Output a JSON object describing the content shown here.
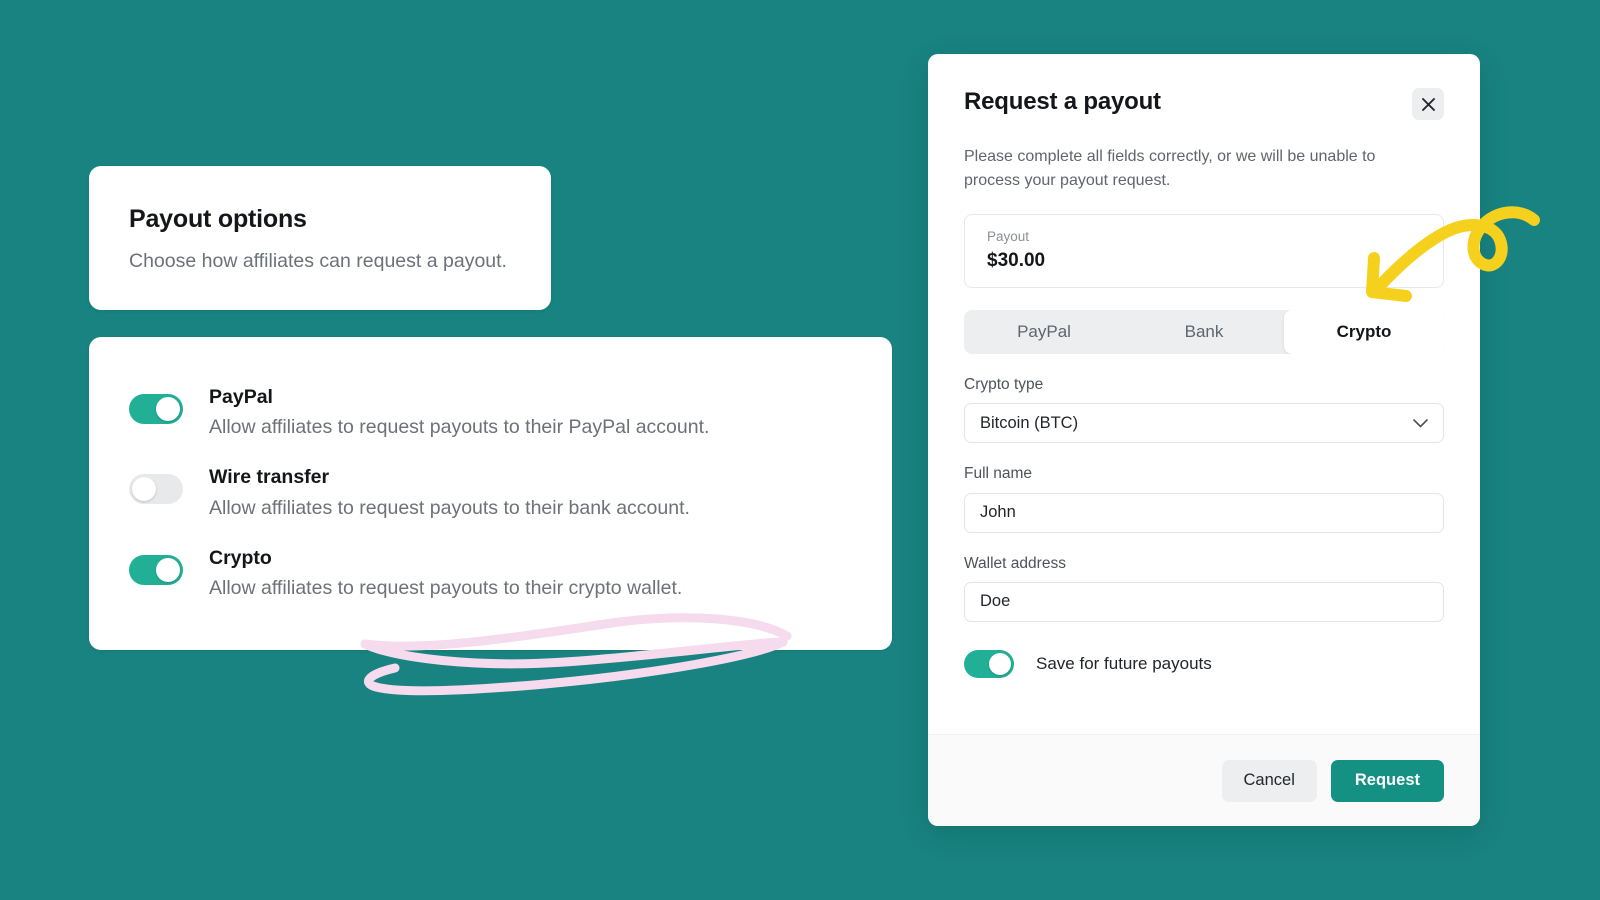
{
  "theme": {
    "background": "#188380",
    "accent_green": "#21b096",
    "primary_button": "#159184",
    "annotation_yellow": "#F5D11E",
    "annotation_pink": "#F6DAEE"
  },
  "payout_options_card": {
    "title": "Payout options",
    "subtitle": "Choose how affiliates can request a payout.",
    "options": [
      {
        "name": "PayPal",
        "description": "Allow affiliates to request payouts to their PayPal account.",
        "enabled": true
      },
      {
        "name": "Wire transfer",
        "description": "Allow affiliates to request payouts to their bank account.",
        "enabled": false
      },
      {
        "name": "Crypto",
        "description": "Allow affiliates to request payouts to their crypto wallet.",
        "enabled": true
      }
    ]
  },
  "modal": {
    "title": "Request a payout",
    "close_icon": "close-icon",
    "description": "Please complete all fields correctly, or we will be unable to process your payout request.",
    "payout_summary": {
      "label": "Payout",
      "value": "$30.00"
    },
    "method_tabs": [
      {
        "label": "PayPal",
        "active": false
      },
      {
        "label": "Bank",
        "active": false
      },
      {
        "label": "Crypto",
        "active": true
      }
    ],
    "fields": [
      {
        "label": "Crypto type",
        "value": "Bitcoin (BTC)",
        "type": "select",
        "icon": "chevron-down-icon"
      },
      {
        "label": "Full name",
        "value": "John",
        "type": "text",
        "placeholder": "Full name"
      },
      {
        "label": "Wallet address",
        "value": "Doe",
        "type": "text",
        "placeholder": "Wallet address"
      }
    ],
    "save_toggle": {
      "label": "Save for future payouts",
      "enabled": true
    },
    "footer": {
      "cancel_label": "Cancel",
      "submit_label": "Request"
    }
  },
  "annotations": [
    {
      "name": "yellow-arrow",
      "color": "#F5D11E",
      "points_to": "payout-amount-field"
    },
    {
      "name": "pink-scribble",
      "color": "#F6DAEE",
      "points_to": "crypto-option-row"
    }
  ]
}
